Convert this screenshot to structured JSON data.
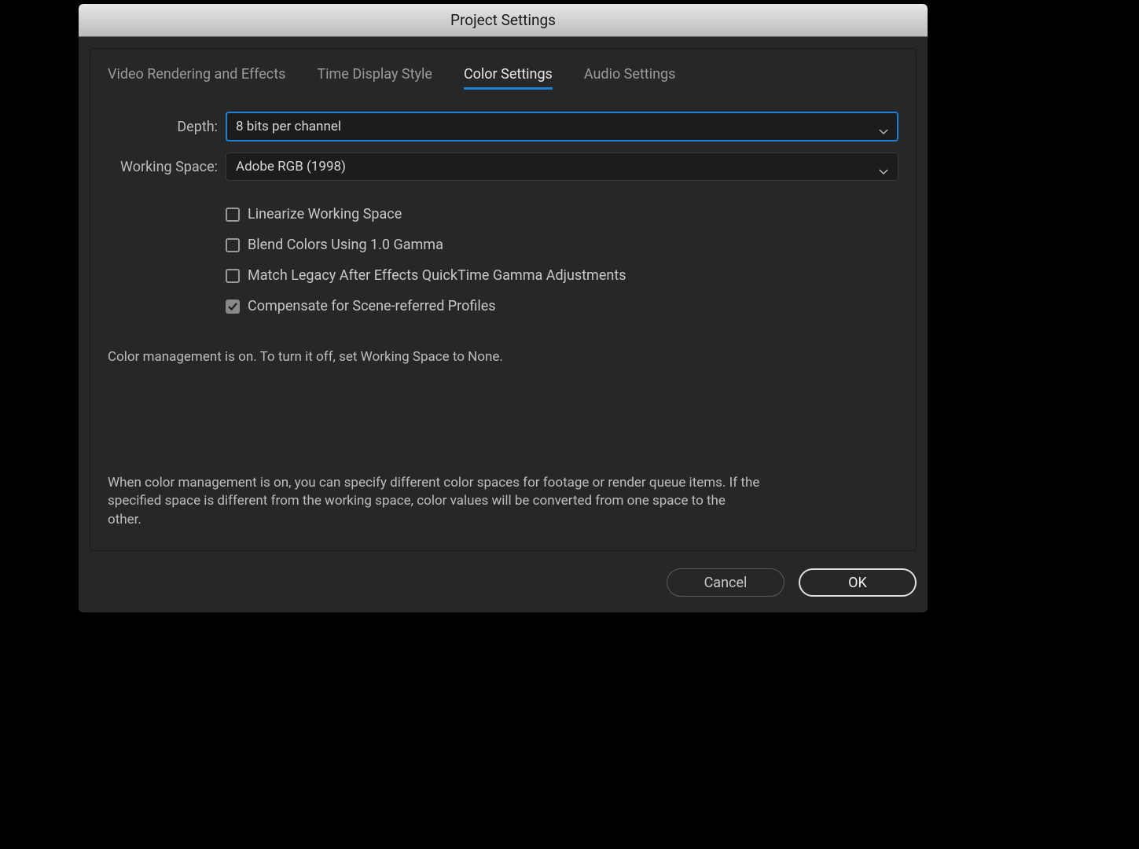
{
  "window": {
    "title": "Project Settings"
  },
  "tabs": {
    "items": [
      {
        "label": "Video Rendering and Effects"
      },
      {
        "label": "Time Display Style"
      },
      {
        "label": "Color Settings"
      },
      {
        "label": "Audio Settings"
      }
    ],
    "active_index": 2
  },
  "form": {
    "depth": {
      "label": "Depth:",
      "value": "8 bits per channel"
    },
    "working_space": {
      "label": "Working Space:",
      "value": "Adobe RGB (1998)"
    },
    "checkboxes": [
      {
        "label": "Linearize Working Space",
        "checked": false
      },
      {
        "label": "Blend Colors Using 1.0 Gamma",
        "checked": false
      },
      {
        "label": "Match Legacy After Effects QuickTime Gamma Adjustments",
        "checked": false
      },
      {
        "label": "Compensate for Scene-referred Profiles",
        "checked": true
      }
    ]
  },
  "info": {
    "line1": "Color management is on. To turn it off, set Working Space to None.",
    "line2": "When color management is on, you can specify different color spaces for footage or render queue items. If the specified space is different from the working space, color values will be converted from one space to the other."
  },
  "buttons": {
    "cancel": "Cancel",
    "ok": "OK"
  }
}
